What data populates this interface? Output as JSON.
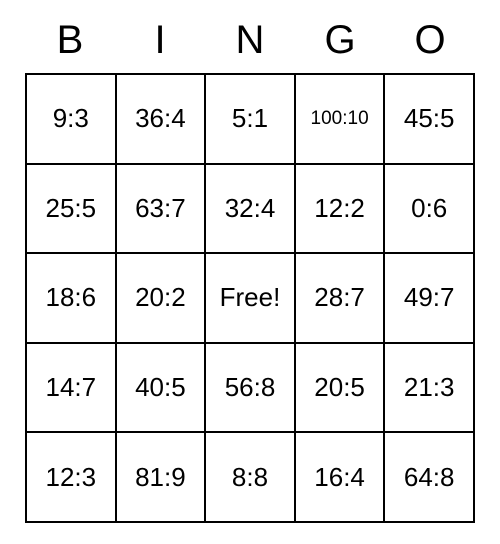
{
  "bingo": {
    "headers": [
      "B",
      "I",
      "N",
      "G",
      "O"
    ],
    "cells": [
      [
        "9:3",
        "36:4",
        "5:1",
        "100:10",
        "45:5"
      ],
      [
        "25:5",
        "63:7",
        "32:4",
        "12:2",
        "0:6"
      ],
      [
        "18:6",
        "20:2",
        "Free!",
        "28:7",
        "49:7"
      ],
      [
        "14:7",
        "40:5",
        "56:8",
        "20:5",
        "21:3"
      ],
      [
        "12:3",
        "81:9",
        "8:8",
        "16:4",
        "64:8"
      ]
    ]
  }
}
